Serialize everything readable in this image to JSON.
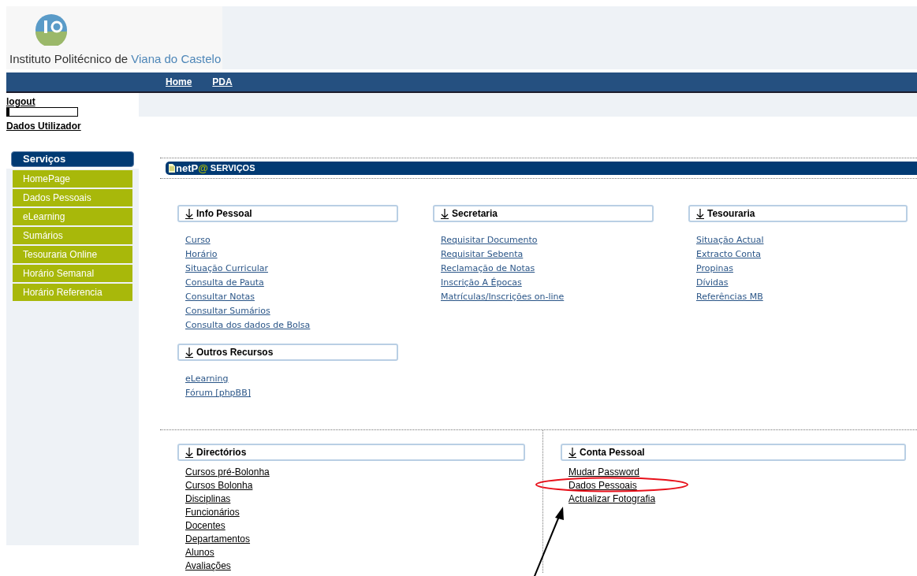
{
  "header": {
    "title_start": "Instituto Politécnico de ",
    "title_end": "Viana do Castelo"
  },
  "nav": [
    "Home",
    "PDA"
  ],
  "user": {
    "logout": "logout",
    "details": "Dados Utilizador"
  },
  "sidebar": {
    "title": "Serviços",
    "items": [
      "HomePage",
      "Dados Pessoais",
      "eLearning",
      "Sumários",
      "Tesouraria Online",
      "Horário Semanal",
      "Horário Referencia"
    ]
  },
  "banner": {
    "brand": "netP",
    "at": "@",
    "title": "SERVIÇOS"
  },
  "columns": [
    [
      {
        "title": "Info Pessoal",
        "links": [
          "Curso",
          "Horário",
          "Situação Curricular",
          "Consulta de Pauta",
          "Consultar Notas",
          "Consultar Sumários",
          "Consulta dos dados de Bolsa"
        ]
      },
      {
        "title": "Outros Recursos",
        "links": [
          "eLearning",
          "Fórum [phpBB]"
        ]
      }
    ],
    [
      {
        "title": "Secretaria",
        "links": [
          "Requisitar Documento",
          "Requisitar Sebenta",
          "Reclamação de Notas",
          "Inscrição A Épocas",
          "Matrículas/Inscrições on-line"
        ]
      }
    ],
    [
      {
        "title": "Tesouraria",
        "links": [
          "Situação Actual",
          "Extracto Conta",
          "Propinas",
          "Dívidas",
          "Referências MB"
        ]
      }
    ]
  ],
  "bottom": [
    {
      "title": "Directórios",
      "links": [
        "Cursos pré-Bolonha",
        "Cursos Bolonha",
        "Disciplinas",
        "Funcionários",
        "Docentes",
        "Departamentos",
        "Alunos",
        "Avaliações"
      ]
    },
    {
      "title": "Conta Pessoal",
      "links": [
        "Mudar Password",
        "Dados Pessoais",
        "Actualizar Fotografia"
      ]
    }
  ]
}
